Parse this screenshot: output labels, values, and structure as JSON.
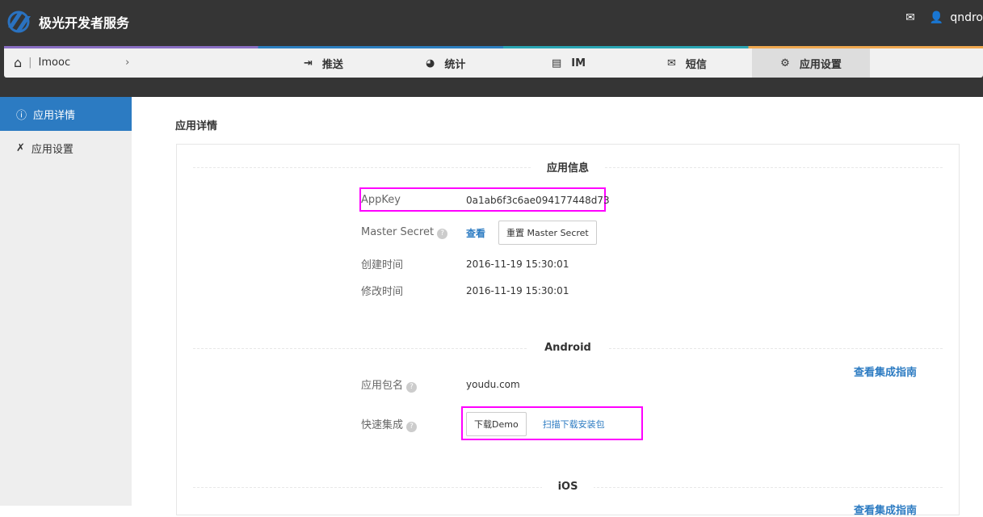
{
  "header": {
    "brand": "极光开发者服务",
    "user": "qndro"
  },
  "nav": {
    "breadcrumb": "Imooc",
    "items": [
      {
        "label": "推送"
      },
      {
        "label": "统计"
      },
      {
        "label": "IM"
      },
      {
        "label": "短信"
      },
      {
        "label": "应用设置"
      }
    ]
  },
  "sidebar": {
    "items": [
      {
        "label": "应用详情"
      },
      {
        "label": "应用设置"
      }
    ]
  },
  "page_title": "应用详情",
  "app_info": {
    "section": "应用信息",
    "appkey_label": "AppKey",
    "appkey": "0a1ab6f3c6ae094177448d73",
    "master_label": "Master Secret",
    "view": "查看",
    "reset": "重置 Master Secret",
    "created_label": "创建时间",
    "created": "2016-11-19 15:30:01",
    "modified_label": "修改时间",
    "modified": "2016-11-19 15:30:01"
  },
  "android": {
    "section": "Android",
    "guide": "查看集成指南",
    "pkg_label": "应用包名",
    "pkg": "youdu.com",
    "quick_label": "快速集成",
    "demo": "下载Demo",
    "scan": "扫描下载安装包"
  },
  "ios": {
    "section": "iOS",
    "guide": "查看集成指南"
  },
  "help_glyph": "?"
}
